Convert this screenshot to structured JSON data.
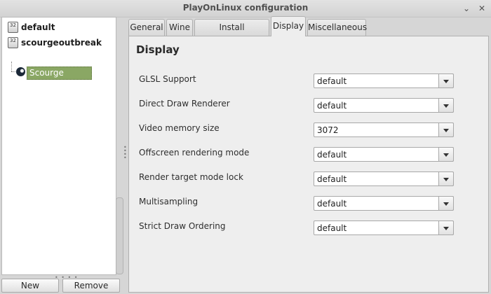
{
  "window": {
    "title": "PlayOnLinux configuration"
  },
  "tree": {
    "items": [
      {
        "label": "default",
        "badge": "32"
      },
      {
        "label": "scourgeoutbreak",
        "badge": "32"
      }
    ],
    "selected_child": "Scourge Outbreak"
  },
  "buttons": {
    "new": "New",
    "remove": "Remove"
  },
  "tabs": [
    "General",
    "Wine",
    "Install components",
    "Display",
    "Miscellaneous"
  ],
  "active_tab": "Display",
  "panel": {
    "title": "Display",
    "settings": [
      {
        "label": "GLSL Support",
        "value": "default"
      },
      {
        "label": "Direct Draw Renderer",
        "value": "default"
      },
      {
        "label": "Video memory size",
        "value": "3072"
      },
      {
        "label": "Offscreen rendering mode",
        "value": "default"
      },
      {
        "label": "Render target mode lock",
        "value": "default"
      },
      {
        "label": "Multisampling",
        "value": "default"
      },
      {
        "label": "Strict Draw Ordering",
        "value": "default"
      }
    ]
  },
  "icons": {
    "minimize": "minimize-icon",
    "close": "close-icon",
    "steam": "steam-icon"
  }
}
